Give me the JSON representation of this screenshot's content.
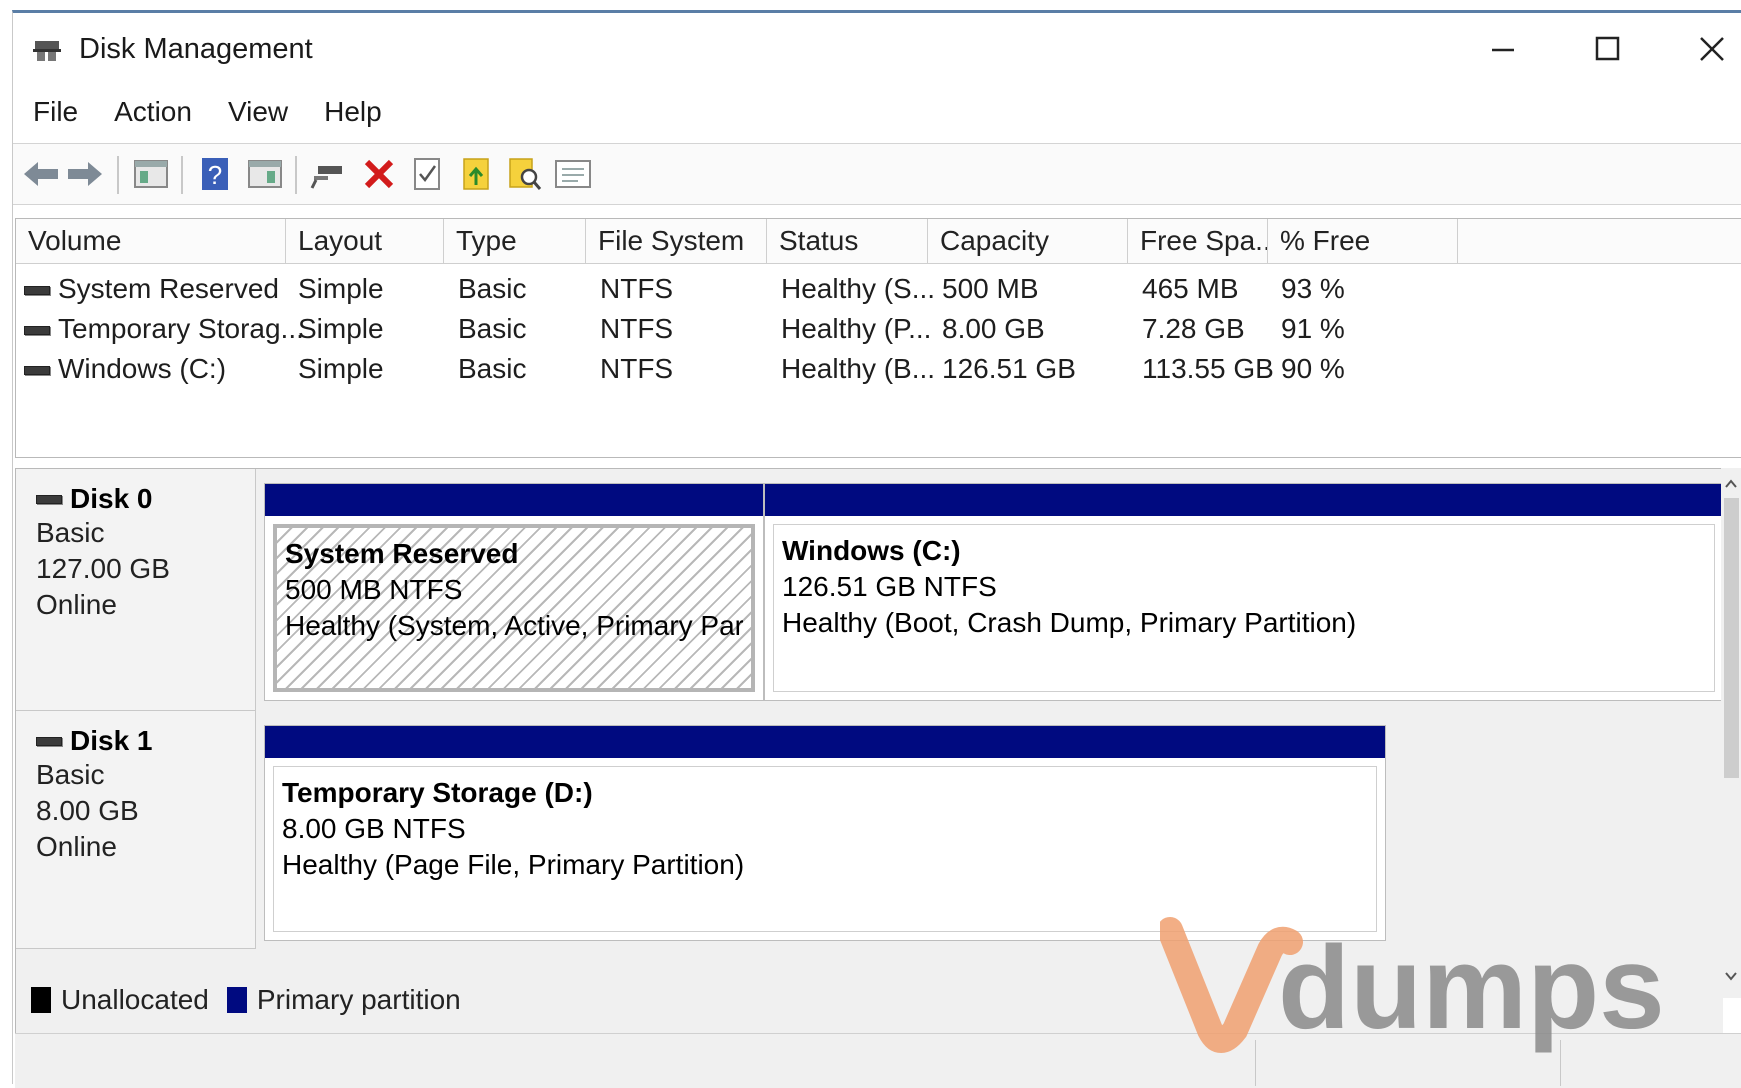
{
  "window": {
    "title": "Disk Management"
  },
  "menu": [
    "File",
    "Action",
    "View",
    "Help"
  ],
  "toolbar": {
    "icons": [
      "back-arrow-icon",
      "forward-arrow-icon",
      "console-tree-icon",
      "help-icon",
      "show-hide-icon",
      "connect-icon",
      "delete-icon",
      "properties-icon",
      "import-icon",
      "search-icon",
      "list-view-icon"
    ]
  },
  "volume_table": {
    "columns": [
      "Volume",
      "Layout",
      "Type",
      "File System",
      "Status",
      "Capacity",
      "Free Spa...",
      "% Free"
    ],
    "rows": [
      {
        "volume": "System Reserved",
        "layout": "Simple",
        "type": "Basic",
        "fs": "NTFS",
        "status": "Healthy (S...",
        "capacity": "500 MB",
        "free": "465 MB",
        "pct": "93 %"
      },
      {
        "volume": "Temporary Storag...",
        "layout": "Simple",
        "type": "Basic",
        "fs": "NTFS",
        "status": "Healthy (P...",
        "capacity": "8.00 GB",
        "free": "7.28 GB",
        "pct": "91 %"
      },
      {
        "volume": "Windows (C:)",
        "layout": "Simple",
        "type": "Basic",
        "fs": "NTFS",
        "status": "Healthy (B...",
        "capacity": "126.51 GB",
        "free": "113.55 GB",
        "pct": "90 %"
      }
    ]
  },
  "disks": [
    {
      "name": "Disk 0",
      "type": "Basic",
      "size": "127.00 GB",
      "state": "Online",
      "partitions": [
        {
          "name": "System Reserved",
          "size": "500 MB NTFS",
          "status": "Healthy (System, Active, Primary Parti"
        },
        {
          "name": "Windows  (C:)",
          "size": "126.51 GB NTFS",
          "status": "Healthy (Boot, Crash Dump, Primary Partition)"
        }
      ]
    },
    {
      "name": "Disk 1",
      "type": "Basic",
      "size": "8.00 GB",
      "state": "Online",
      "partitions": [
        {
          "name": "Temporary Storage  (D:)",
          "size": "8.00 GB NTFS",
          "status": "Healthy (Page File, Primary Partition)"
        }
      ]
    }
  ],
  "legend": [
    {
      "label": "Unallocated",
      "color": "#000000"
    },
    {
      "label": "Primary partition",
      "color": "#000a80"
    }
  ],
  "watermark": {
    "text": "vdumps",
    "colors": {
      "v": "#f0a070",
      "rest": "#8a8a8a"
    }
  }
}
